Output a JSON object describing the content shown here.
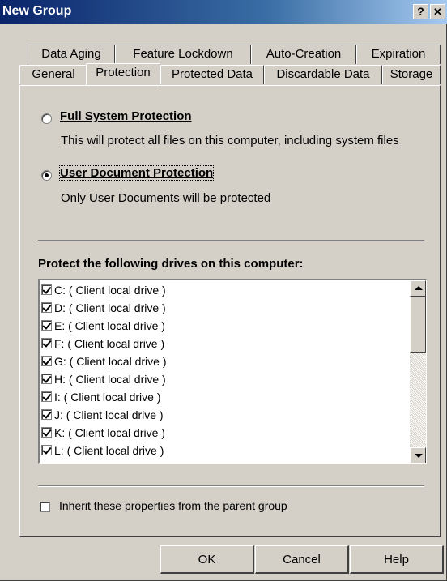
{
  "window": {
    "title": "New Group",
    "help_button": "?",
    "close_button": "✕"
  },
  "tabs_row1": [
    "Data Aging",
    "Feature Lockdown",
    "Auto-Creation",
    "Expiration"
  ],
  "tabs_row2": [
    "General",
    "Protection",
    "Protected Data",
    "Discardable Data",
    "Storage"
  ],
  "active_tab": "Protection",
  "protection": {
    "full": {
      "label": "Full System Protection",
      "description": "This will protect all files on this computer, including system files",
      "selected": false
    },
    "user": {
      "label": "User Document Protection",
      "description": "Only User Documents will be protected",
      "selected": true
    }
  },
  "drives": {
    "heading": "Protect the following drives on this computer:",
    "items": [
      {
        "label": "C: ( Client local drive )",
        "checked": true
      },
      {
        "label": "D: ( Client local drive )",
        "checked": true
      },
      {
        "label": "E: ( Client local drive )",
        "checked": true
      },
      {
        "label": "F: ( Client local drive )",
        "checked": true
      },
      {
        "label": "G: ( Client local drive )",
        "checked": true
      },
      {
        "label": "H: ( Client local drive )",
        "checked": true
      },
      {
        "label": "I: ( Client local drive )",
        "checked": true
      },
      {
        "label": "J: ( Client local drive )",
        "checked": true
      },
      {
        "label": "K: ( Client local drive )",
        "checked": true
      },
      {
        "label": "L: ( Client local drive )",
        "checked": true
      }
    ]
  },
  "inherit": {
    "label": "Inherit these properties from the parent group",
    "checked": false
  },
  "buttons": {
    "ok": "OK",
    "cancel": "Cancel",
    "help": "Help"
  }
}
